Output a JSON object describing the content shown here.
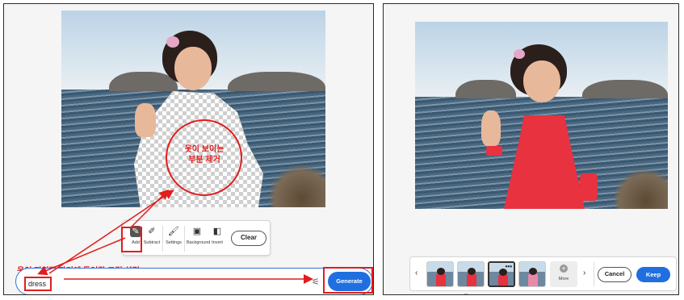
{
  "left_panel": {
    "annotation_removed": "옷이 보이는\n부분 제거",
    "annotation_prompt": "옷이 지워진 자리에 들어갈 그림 설명",
    "toolbar": {
      "add": "Add",
      "subtract": "Subtract",
      "settings": "Settings",
      "background": "Background",
      "invert": "Invert",
      "clear": "Clear"
    },
    "prompt": {
      "value": "dress",
      "generate": "Generate"
    }
  },
  "right_panel": {
    "more": "More",
    "cancel": "Cancel",
    "keep": "Keep",
    "prev_icon": "‹",
    "next_icon": "›"
  },
  "colors": {
    "annotation": "#e11d1d",
    "accent": "#1f6fe0",
    "dress": "#e8323f"
  }
}
